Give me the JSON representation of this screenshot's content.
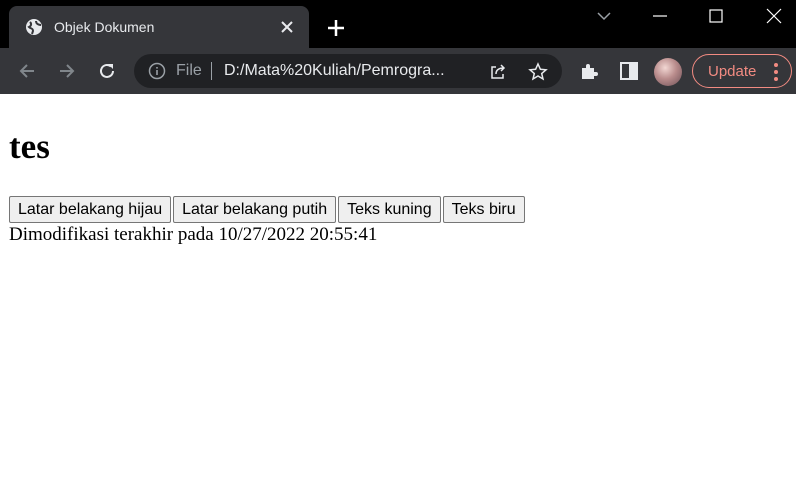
{
  "browser": {
    "tab": {
      "title": "Objek Dokumen"
    },
    "omnibox": {
      "scheme": "File",
      "url": "D:/Mata%20Kuliah/Pemrogra..."
    },
    "update_label": "Update"
  },
  "page": {
    "heading": "tes",
    "buttons": [
      "Latar belakang hijau",
      "Latar belakang putih",
      "Teks kuning",
      "Teks biru"
    ],
    "modified_text": "Dimodifikasi terakhir pada 10/27/2022 20:55:41"
  },
  "colors": {
    "titlebar": "#000000",
    "toolbar": "#35363a",
    "omnibox": "#202124",
    "update_accent": "#f28b82"
  }
}
